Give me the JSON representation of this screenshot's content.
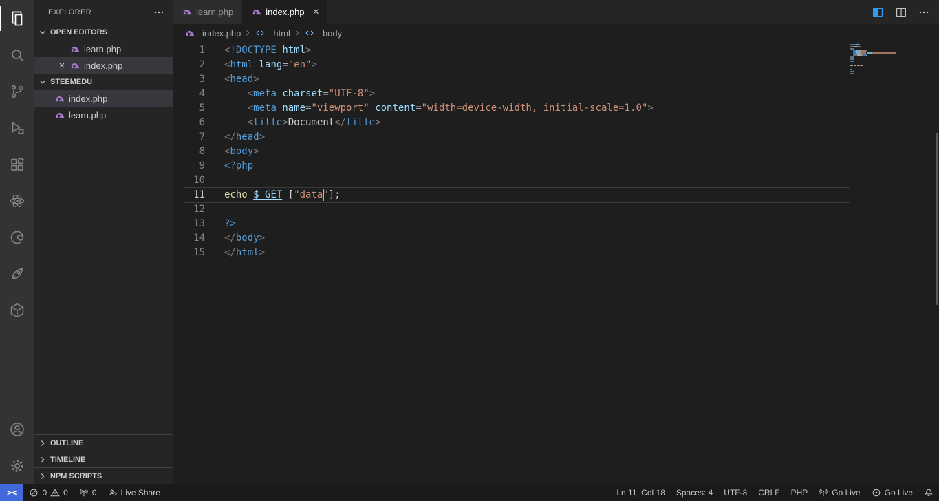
{
  "colors": {
    "php_icon": "#ab7ad1",
    "remote_bg": "#4169d9",
    "action_blue": "#2f9cf4",
    "symbol_icon": "#75beff",
    "activity_bar_bg": "#333333",
    "sidebar_bg": "#252526",
    "editor_bg": "#1e1e1e",
    "status_bar_bg": "#1a1a1a"
  },
  "activity_bar": {
    "icons": [
      "files",
      "search",
      "source-control",
      "run-and-debug",
      "extensions",
      "atom",
      "edge",
      "rocket",
      "cube"
    ],
    "bottom_icons": [
      "account",
      "settings-gear"
    ],
    "active": "files"
  },
  "sidebar": {
    "title": "EXPLORER",
    "open_editors": {
      "label": "OPEN EDITORS",
      "items": [
        {
          "label": "learn.php"
        },
        {
          "label": "index.php",
          "close": "×",
          "active": true
        }
      ]
    },
    "folder": {
      "label": "STEEMEDU",
      "items": [
        {
          "label": "index.php",
          "selected": true
        },
        {
          "label": "learn.php"
        }
      ]
    },
    "panels": [
      {
        "label": "OUTLINE"
      },
      {
        "label": "TIMELINE"
      },
      {
        "label": "NPM SCRIPTS"
      }
    ]
  },
  "tab_bar": {
    "close_label": "×",
    "tabs": [
      {
        "label": "learn.php",
        "active": false
      },
      {
        "label": "index.php",
        "active": true
      }
    ]
  },
  "breadcrumb": {
    "items": [
      {
        "label": "index.php",
        "icon": "php"
      },
      {
        "label": "html",
        "icon": "symbol"
      },
      {
        "label": "body",
        "icon": "symbol"
      }
    ]
  },
  "editor": {
    "active_line": 11,
    "cursor_col": 18,
    "token_colors": {
      "punct": "#808080",
      "tag": "#569cd6",
      "attr": "#9cdcfe",
      "str": "#ce9178",
      "plain": "#d4d4d4",
      "fn": "#dcdcaa",
      "var": "#9cdcfe",
      "meta": "#569cd6"
    },
    "lines": [
      {
        "num": 1,
        "tokens": [
          {
            "t": "<!",
            "c": "punct"
          },
          {
            "t": "DOCTYPE",
            "c": "tag"
          },
          {
            "t": " ",
            "c": "plain"
          },
          {
            "t": "html",
            "c": "attr"
          },
          {
            "t": ">",
            "c": "punct"
          }
        ]
      },
      {
        "num": 2,
        "tokens": [
          {
            "t": "<",
            "c": "punct"
          },
          {
            "t": "html",
            "c": "tag"
          },
          {
            "t": " ",
            "c": "plain"
          },
          {
            "t": "lang",
            "c": "attr"
          },
          {
            "t": "=",
            "c": "plain"
          },
          {
            "t": "\"en\"",
            "c": "str"
          },
          {
            "t": ">",
            "c": "punct"
          }
        ]
      },
      {
        "num": 3,
        "tokens": [
          {
            "t": "<",
            "c": "punct"
          },
          {
            "t": "head",
            "c": "tag"
          },
          {
            "t": ">",
            "c": "punct"
          }
        ]
      },
      {
        "num": 4,
        "tokens": [
          {
            "t": "    ",
            "c": "plain"
          },
          {
            "t": "<",
            "c": "punct"
          },
          {
            "t": "meta",
            "c": "tag"
          },
          {
            "t": " ",
            "c": "plain"
          },
          {
            "t": "charset",
            "c": "attr"
          },
          {
            "t": "=",
            "c": "plain"
          },
          {
            "t": "\"UTF-8\"",
            "c": "str"
          },
          {
            "t": ">",
            "c": "punct"
          }
        ]
      },
      {
        "num": 5,
        "tokens": [
          {
            "t": "    ",
            "c": "plain"
          },
          {
            "t": "<",
            "c": "punct"
          },
          {
            "t": "meta",
            "c": "tag"
          },
          {
            "t": " ",
            "c": "plain"
          },
          {
            "t": "name",
            "c": "attr"
          },
          {
            "t": "=",
            "c": "plain"
          },
          {
            "t": "\"viewport\"",
            "c": "str"
          },
          {
            "t": " ",
            "c": "plain"
          },
          {
            "t": "content",
            "c": "attr"
          },
          {
            "t": "=",
            "c": "plain"
          },
          {
            "t": "\"width=device-width, initial-scale=1.0\"",
            "c": "str"
          },
          {
            "t": ">",
            "c": "punct"
          }
        ]
      },
      {
        "num": 6,
        "tokens": [
          {
            "t": "    ",
            "c": "plain"
          },
          {
            "t": "<",
            "c": "punct"
          },
          {
            "t": "title",
            "c": "tag"
          },
          {
            "t": ">",
            "c": "punct"
          },
          {
            "t": "Document",
            "c": "plain"
          },
          {
            "t": "</",
            "c": "punct"
          },
          {
            "t": "title",
            "c": "tag"
          },
          {
            "t": ">",
            "c": "punct"
          }
        ]
      },
      {
        "num": 7,
        "tokens": [
          {
            "t": "</",
            "c": "punct"
          },
          {
            "t": "head",
            "c": "tag"
          },
          {
            "t": ">",
            "c": "punct"
          }
        ]
      },
      {
        "num": 8,
        "tokens": [
          {
            "t": "<",
            "c": "punct"
          },
          {
            "t": "body",
            "c": "tag"
          },
          {
            "t": ">",
            "c": "punct"
          }
        ]
      },
      {
        "num": 9,
        "tokens": [
          {
            "t": "<?php",
            "c": "meta"
          }
        ]
      },
      {
        "num": 10,
        "tokens": []
      },
      {
        "num": 11,
        "tokens": [
          {
            "t": "echo",
            "c": "fn"
          },
          {
            "t": " ",
            "c": "plain"
          },
          {
            "t": "$_GET",
            "c": "var",
            "u": true
          },
          {
            "t": " ",
            "c": "plain"
          },
          {
            "t": "[",
            "c": "plain"
          },
          {
            "t": "\"data\"",
            "c": "str"
          },
          {
            "t": "]",
            "c": "plain"
          },
          {
            "t": ";",
            "c": "plain"
          }
        ]
      },
      {
        "num": 12,
        "tokens": []
      },
      {
        "num": 13,
        "tokens": [
          {
            "t": "?>",
            "c": "meta"
          }
        ]
      },
      {
        "num": 14,
        "tokens": [
          {
            "t": "</",
            "c": "punct"
          },
          {
            "t": "body",
            "c": "tag"
          },
          {
            "t": ">",
            "c": "punct"
          }
        ]
      },
      {
        "num": 15,
        "tokens": [
          {
            "t": "</",
            "c": "punct"
          },
          {
            "t": "html",
            "c": "tag"
          },
          {
            "t": ">",
            "c": "punct"
          }
        ]
      }
    ]
  },
  "status_bar": {
    "remote": {
      "label": "><"
    },
    "problems": {
      "errors": "0",
      "warnings": "0"
    },
    "ports": {
      "count": "0"
    },
    "live_share": {
      "label": "Live Share"
    },
    "cursor": "Ln 11, Col 18",
    "indentation": "Spaces: 4",
    "encoding": "UTF-8",
    "eol": "CRLF",
    "language": "PHP",
    "go_live_1": "Go Live",
    "go_live_2": "Go Live"
  }
}
